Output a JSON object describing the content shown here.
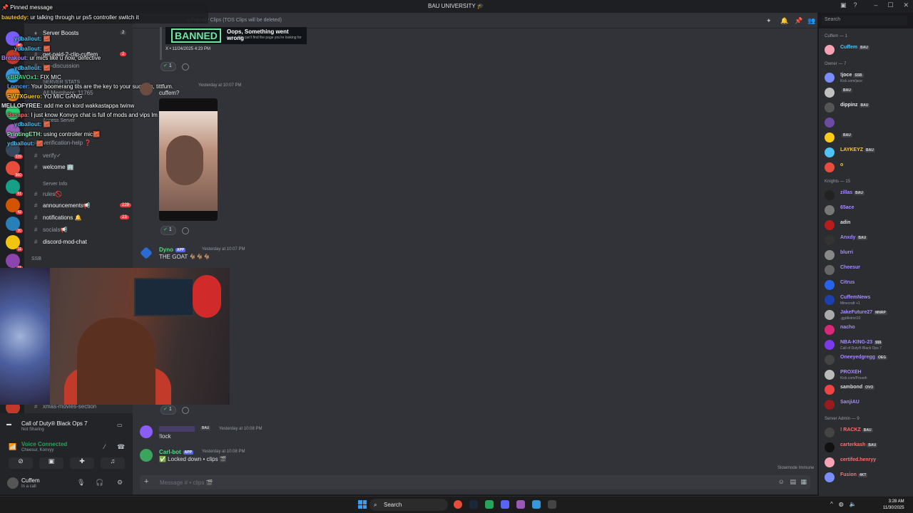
{
  "window": {
    "title": "BAU UNIVERSITY 🎓",
    "topic": "n Friendly Clips (TOS Clips will be deleted)"
  },
  "overlay": {
    "pinned_label": "Pinned message",
    "lines": [
      {
        "user": "bauteddy:",
        "text": "ur talking through ur ps5 controller switch it",
        "color": "#f0c040"
      },
      {
        "user": "ydballout:",
        "text": "🧱",
        "color": "#4fc3f7"
      },
      {
        "user": "ydballout:",
        "text": "🧱",
        "color": "#4fc3f7"
      },
      {
        "user": "Breakout:",
        "text": "ur mics like u now, defective",
        "color": "#a78bfa"
      },
      {
        "user": "ydballout:",
        "text": "🧱",
        "color": "#4fc3f7"
      },
      {
        "user": "xBRAVOx1:",
        "text": "FIX MIC",
        "color": "#4ade80"
      },
      {
        "user": "Lomcer:",
        "text": "Your boomerang tits are the key to your success, tittfum.",
        "color": "#60a5fa"
      },
      {
        "user": "FWTXGuero:",
        "text": "YO MIC GANG",
        "color": "#facc15"
      },
      {
        "user": "MELLOFYREE:",
        "text": "add me on kord wakkastappa twinw",
        "color": "#e5e7eb"
      },
      {
        "user": "Basapa:",
        "text": "I just know Konvys chat is full of mods and vips lm",
        "color": "#f87171"
      },
      {
        "user": "ydballout:",
        "text": "🧱",
        "color": "#4fc3f7"
      },
      {
        "user": "PrintingETH:",
        "text": "using controller mic🧱",
        "color": "#86efac"
      },
      {
        "user": "ydballout:",
        "text": "🧱",
        "color": "#4fc3f7"
      }
    ]
  },
  "channels": [
    {
      "label": "Server Boosts",
      "count": "2",
      "bright": true
    },
    {
      "label": "get-paid-2-clip-cuffem",
      "count": "2",
      "bright": true
    },
    {
      "label": "irm-discussion",
      "count": "",
      "bright": false
    },
    {
      "label": "SERVER STATS",
      "count": "",
      "bright": false
    },
    {
      "label": "All Members: 11765",
      "count": "",
      "bright": false
    },
    {
      "label": "Access Server",
      "count": "",
      "bright": false
    },
    {
      "label": "verification-help ❓",
      "count": "",
      "bright": false
    },
    {
      "label": "verify✓",
      "count": "",
      "bright": false
    },
    {
      "label": "welcome 🏢",
      "count": "",
      "bright": true
    },
    {
      "label": "Server Info",
      "count": "",
      "bright": false
    },
    {
      "label": "rules🚫",
      "count": "",
      "bright": false
    },
    {
      "label": "announcements📢",
      "count": "229",
      "bright": true
    },
    {
      "label": "notifications 🔔",
      "count": "23",
      "bright": true
    },
    {
      "label": "socials📢",
      "count": "",
      "bright": false
    },
    {
      "label": "discord-mod-chat",
      "count": "",
      "bright": true
    },
    {
      "label": "SSB",
      "count": "",
      "bright": false
    },
    {
      "label": "xmas-movies-section",
      "count": "",
      "bright": false
    }
  ],
  "voice": {
    "game": "Call of Duty® Black Ops 7",
    "game_status": "Not Sharing",
    "connected": "Voice Connected",
    "channel": "Cheesur, Konvyy",
    "user": "Cuffem",
    "user_status": "In a call"
  },
  "messages": {
    "banned_text": "BANNED",
    "banned_title": "Oops, Something went wrong",
    "banned_sub": "We can't find the page you're looking for",
    "banned_meta": "X • 11/24/2025 4:23 PM",
    "react_count_1": "1",
    "time_1": "Yesterday at 10:07 PM",
    "text_1": "cuffem?",
    "dyno_name": "Dyno",
    "dyno_time": "Yesterday at 10:07 PM",
    "dyno_text": "THE GOAT 🐐🐐🐐",
    "react_count_2": "1",
    "react_count_3": "1",
    "msg4_tag": "BAU",
    "msg4_time": "Yesterday at 10:08 PM",
    "msg4_text": "!lock",
    "carl_name": "Carl-bot",
    "carl_time": "Yesterday at 10:08 PM",
    "carl_text": "✅ Locked down • clips 🎬",
    "app_tag": "APP"
  },
  "composer": {
    "placeholder": "Message # • clips 🎬",
    "slowmode": "Slowmode Immune"
  },
  "members": {
    "search_placeholder": "Search",
    "groups": [
      {
        "label": "Cuffem — 1",
        "items": [
          {
            "name": "Cuffem",
            "tag": "BAU",
            "status": "",
            "color": "#4fc3f7"
          }
        ]
      },
      {
        "label": "Owner — 7",
        "items": [
          {
            "name": "!joce",
            "tag": "SSB",
            "status": "Kick.com/jace",
            "color": "#e5e7eb"
          },
          {
            "name": "",
            "tag": "BAU",
            "status": "",
            "color": "#e5e7eb"
          },
          {
            "name": "dippinz",
            "tag": "BAU",
            "status": "",
            "color": "#e5e7eb"
          },
          {
            "name": "",
            "tag": "",
            "status": "",
            "color": "#e5e7eb"
          },
          {
            "name": "",
            "tag": "BAU",
            "status": "",
            "color": "#e5e7eb"
          },
          {
            "name": "LAYKEYZ",
            "tag": "BAU",
            "status": "",
            "color": "#facc15"
          },
          {
            "name": "o",
            "tag": "",
            "status": "",
            "color": "#facc15"
          }
        ]
      },
      {
        "label": "Knights — 15",
        "items": [
          {
            "name": "zillas",
            "tag": "BAU",
            "status": "",
            "color": "#a78bfa"
          },
          {
            "name": "65ace",
            "tag": "",
            "status": "",
            "color": "#a78bfa"
          },
          {
            "name": "adin",
            "tag": "",
            "status": "",
            "color": "#dbdee1"
          },
          {
            "name": "Anxdy",
            "tag": "BAU",
            "status": "",
            "color": "#a78bfa"
          },
          {
            "name": "blurri",
            "tag": "",
            "status": "",
            "color": "#a78bfa"
          },
          {
            "name": "Cheesur",
            "tag": "",
            "status": "",
            "color": "#a78bfa"
          },
          {
            "name": "Citrus",
            "tag": "",
            "status": "",
            "color": "#a78bfa"
          },
          {
            "name": "CuffemNews",
            "tag": "",
            "status": "Minecraft +1",
            "color": "#a78bfa"
          },
          {
            "name": "JakeFuture27",
            "tag": "MNRP",
            "status": ".gg/district10",
            "color": "#a78bfa"
          },
          {
            "name": "nacho",
            "tag": "",
            "status": "",
            "color": "#a78bfa"
          },
          {
            "name": "NBA-KING-23",
            "tag": "$$$",
            "status": "Call of Duty® Black Ops 7",
            "color": "#a78bfa"
          },
          {
            "name": "Oneeyedgregg",
            "tag": "OEG",
            "status": "",
            "color": "#a78bfa"
          },
          {
            "name": "PROXEH",
            "tag": "",
            "status": "Kick.com/Proxeh",
            "color": "#a78bfa"
          },
          {
            "name": "sambond",
            "tag": "OVO",
            "status": "",
            "color": "#dbdee1"
          },
          {
            "name": "SanjiAU",
            "tag": "",
            "status": "",
            "color": "#a78bfa"
          }
        ]
      },
      {
        "label": "Server Admin — 9",
        "items": [
          {
            "name": "! RACKZ",
            "tag": "BAU",
            "status": "",
            "color": "#f87171"
          },
          {
            "name": "carterkash",
            "tag": "BAU",
            "status": "",
            "color": "#f87171"
          },
          {
            "name": "certifed.henryy",
            "tag": "",
            "status": "",
            "color": "#f87171"
          },
          {
            "name": "Fusion",
            "tag": "4KT",
            "status": "",
            "color": "#f87171"
          }
        ]
      }
    ]
  },
  "taskbar": {
    "search": "Search",
    "time": "3:28 AM",
    "date": "11/30/2025"
  },
  "colors": {
    "accent": "#5865f2",
    "online": "#23a55a",
    "danger": "#f23f43"
  }
}
